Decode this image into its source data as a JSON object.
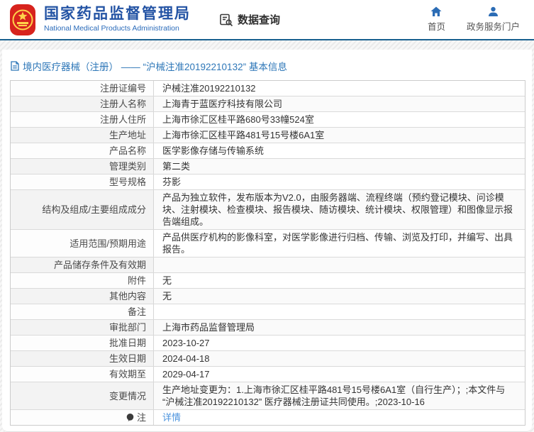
{
  "header": {
    "agency_name_cn": "国家药品监督管理局",
    "agency_name_en": "National Medical Products Administration",
    "data_query_label": "数据查询",
    "nav": [
      {
        "label": "首页",
        "icon": "home-icon"
      },
      {
        "label": "政务服务门户",
        "icon": "person-icon"
      }
    ]
  },
  "page": {
    "title": "境内医疗器械（注册） —— “沪械注准20192210132” 基本信息"
  },
  "table": {
    "rows": [
      {
        "label": "注册证编号",
        "value": "沪械注准20192210132"
      },
      {
        "label": "注册人名称",
        "value": "上海青于蓝医疗科技有限公司"
      },
      {
        "label": "注册人住所",
        "value": "上海市徐汇区桂平路680号33幢524室"
      },
      {
        "label": "生产地址",
        "value": "上海市徐汇区桂平路481号15号楼6A1室"
      },
      {
        "label": "产品名称",
        "value": "医学影像存储与传输系统"
      },
      {
        "label": "管理类别",
        "value": "第二类"
      },
      {
        "label": "型号规格",
        "value": "芬影"
      },
      {
        "label": "结构及组成/主要组成成分",
        "value": "产品为独立软件，发布版本为V2.0，由服务器端、流程终端（预约登记模块、问诊模块、注射模块、检查模块、报告模块、随访模块、统计模块、权限管理）和图像显示报告端组成。"
      },
      {
        "label": "适用范围/预期用途",
        "value": "产品供医疗机构的影像科室，对医学影像进行归档、传输、浏览及打印，并编写、出具报告。"
      },
      {
        "label": "产品储存条件及有效期",
        "value": ""
      },
      {
        "label": "附件",
        "value": "无"
      },
      {
        "label": "其他内容",
        "value": "无"
      },
      {
        "label": "备注",
        "value": ""
      },
      {
        "label": "审批部门",
        "value": "上海市药品监督管理局"
      },
      {
        "label": "批准日期",
        "value": "2023-10-27"
      },
      {
        "label": "生效日期",
        "value": "2024-04-18"
      },
      {
        "label": "有效期至",
        "value": "2029-04-17"
      },
      {
        "label": "变更情况",
        "value": "生产地址变更为：1.上海市徐汇区桂平路481号15号楼6A1室（自行生产）；;本文件与 “沪械注准20192210132” 医疗器械注册证共同使用。;2023-10-16"
      }
    ],
    "note_label": "注",
    "note_link_label": "详情"
  },
  "colors": {
    "brand_blue": "#2353a4",
    "header_border": "#19608f",
    "title_blue": "#2e77b8",
    "link_blue": "#4b93dd",
    "emblem_red": "#d7231d",
    "emblem_gold": "#ffd24a"
  }
}
